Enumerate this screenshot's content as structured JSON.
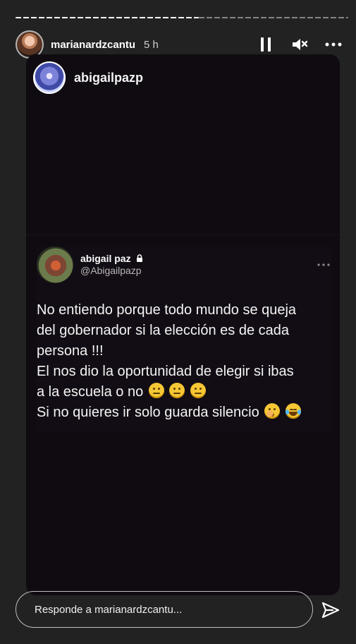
{
  "story": {
    "progress": {
      "segments": 2,
      "current_index": 0,
      "current_fraction": 0.55
    },
    "header": {
      "username": "marianardzcantu",
      "time": "5 h",
      "controls": {
        "pause_icon": "pause-icon",
        "mute_icon": "mute-icon",
        "more_icon": "more-icon"
      }
    },
    "card": {
      "shared_username": "abigailpazp"
    },
    "tweet": {
      "name": "abigail paz",
      "handle": "@Abigailpazp",
      "lines": [
        "No entiendo porque todo mundo se queja",
        "del gobernador si la elección es de cada",
        "persona !!!",
        "El nos dio la oportunidad de elegir si ibas",
        "a la escuela o no",
        "Si no quieres ir solo guarda silencio"
      ],
      "emoji_names": {
        "line5": [
          "neutral-face-icon",
          "neutral-face-icon",
          "neutral-face-icon"
        ],
        "line6": [
          "shushing-face-icon",
          "laughing-face-icon"
        ]
      }
    },
    "reply": {
      "placeholder": "Responde a marianardzcantu..."
    },
    "colors": {
      "background": "#222222",
      "card_background": "#0f0b11",
      "text": "#ffffff"
    }
  }
}
